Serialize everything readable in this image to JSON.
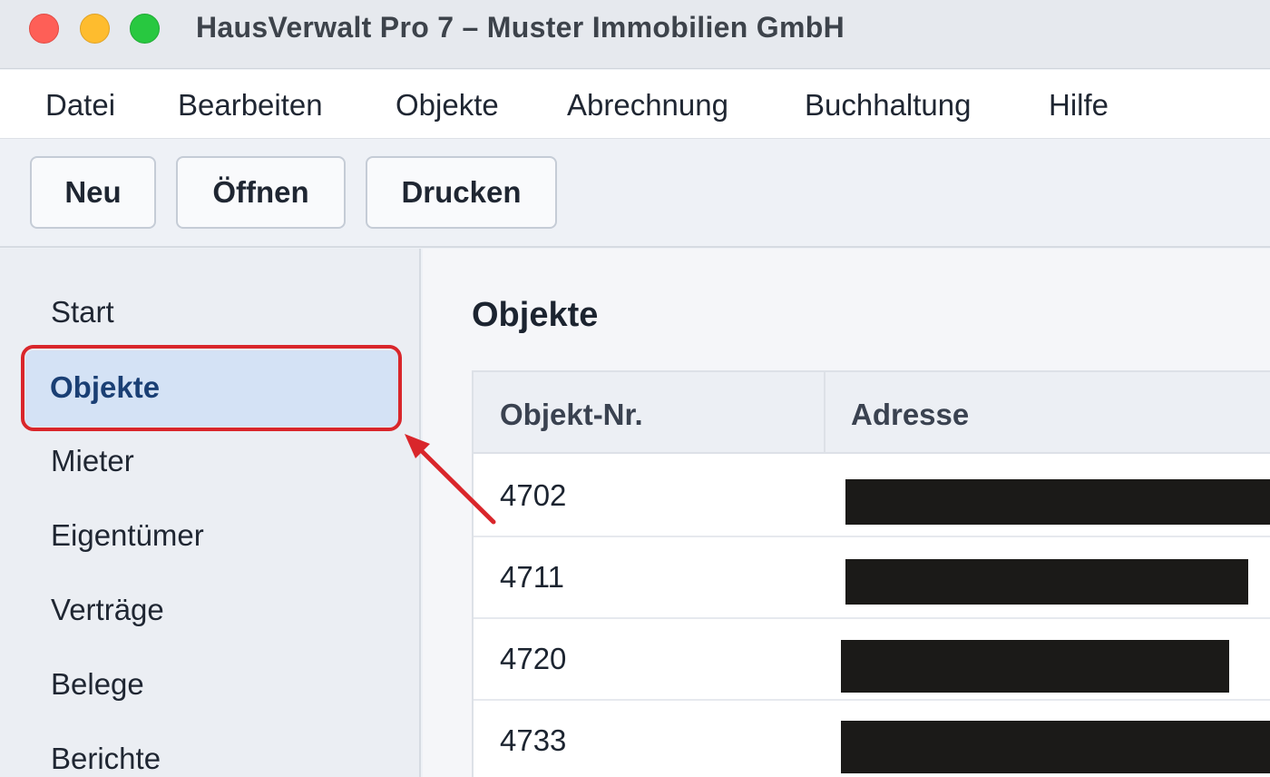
{
  "window": {
    "title": "HausVerwalt Pro 7 – Muster Immobilien GmbH"
  },
  "menu": {
    "items": [
      "Datei",
      "Bearbeiten",
      "Objekte",
      "Abrechnung",
      "Buchhaltung",
      "Hilfe"
    ]
  },
  "toolbar": {
    "new_label": "Neu",
    "open_label": "Öffnen",
    "print_label": "Drucken"
  },
  "sidebar": {
    "items": [
      "Start",
      "Objekte",
      "Mieter",
      "Eigentümer",
      "Verträge",
      "Belege",
      "Berichte"
    ],
    "selected": "Objekte"
  },
  "main": {
    "title": "Objekte",
    "table": {
      "columns": [
        "Objekt-Nr.",
        "Adresse"
      ],
      "rows": [
        {
          "nr": "4702",
          "address": ""
        },
        {
          "nr": "4711",
          "address": ""
        },
        {
          "nr": "4720",
          "address": ""
        },
        {
          "nr": "4733",
          "address": ""
        }
      ]
    }
  },
  "colors": {
    "highlight": "#d9262b",
    "selected_bg": "#d4e2f5",
    "selected_text": "#1a3f74"
  }
}
